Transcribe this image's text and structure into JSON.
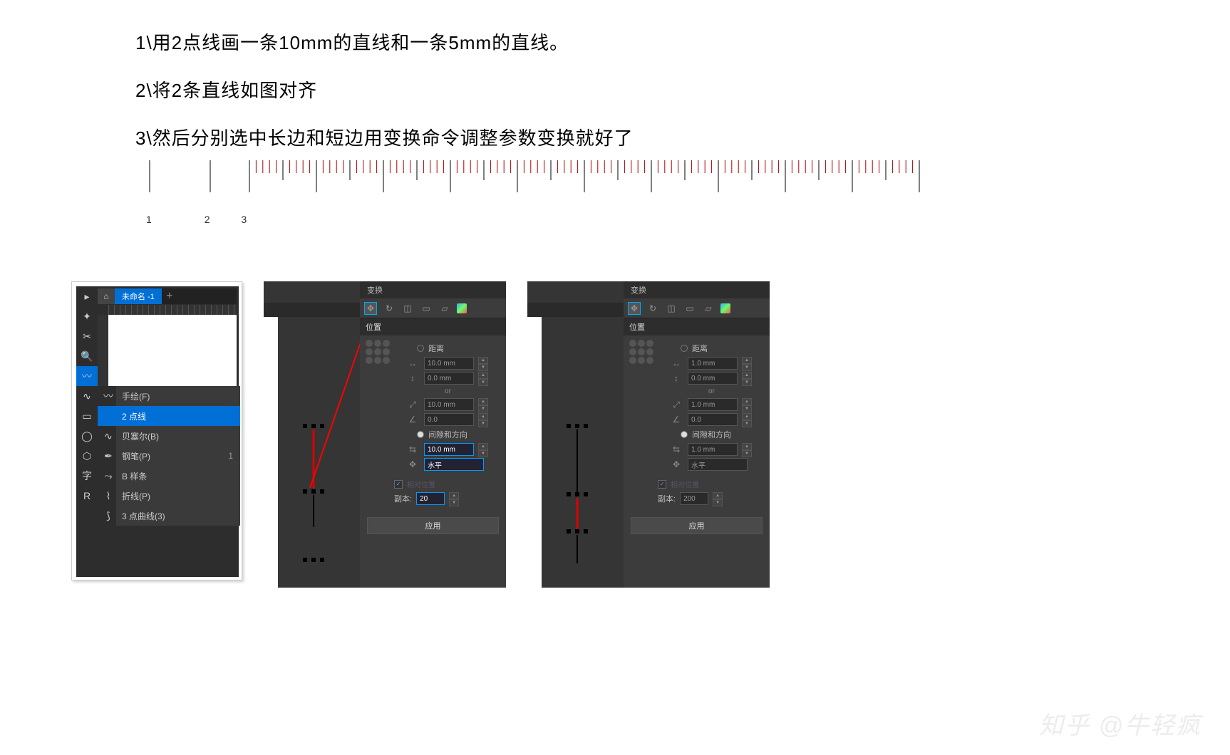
{
  "instructions": {
    "step1": "1\\用2点线画一条10mm的直线和一条5mm的直线。",
    "step2": "2\\将2条直线如图对齐",
    "step3": "3\\然后分别选中长边和短边用变换命令调整参数变换就好了"
  },
  "ruler_labels": {
    "n1": "1",
    "n2": "2",
    "n3": "3"
  },
  "panel1": {
    "tab_title": "未命名 -1",
    "flyout_items": [
      {
        "label": "手绘(F)",
        "shortcut": ""
      },
      {
        "label": "2 点线",
        "shortcut": "",
        "selected": true
      },
      {
        "label": "贝塞尔(B)",
        "shortcut": ""
      },
      {
        "label": "钢笔(P)",
        "shortcut": "1"
      },
      {
        "label": "B 样条",
        "shortcut": ""
      },
      {
        "label": "折线(P)",
        "shortcut": ""
      },
      {
        "label": "3 点曲线(3)",
        "shortcut": ""
      }
    ],
    "text_tool": "字"
  },
  "transform": {
    "title": "变换",
    "section_position": "位置",
    "radio_distance": "距离",
    "radio_gap_dir": "间隙和方向",
    "or_label": "or",
    "dir_label": "水平",
    "checkbox_relative": "相对位置",
    "copies_label": "副本:",
    "apply_label": "应用"
  },
  "panel2": {
    "dist_h": "10.0 mm",
    "dist_v": "0.0 mm",
    "angle_len": "10.0 mm",
    "angle_deg": "0.0",
    "gap_val": "10.0 mm",
    "copies_val": "20"
  },
  "panel3": {
    "dist_h": "1.0 mm",
    "dist_v": "0.0 mm",
    "angle_len": "1.0 mm",
    "angle_deg": "0.0",
    "gap_val": "1.0 mm",
    "copies_val": "200"
  },
  "watermark": "知乎 @牛轻疯"
}
